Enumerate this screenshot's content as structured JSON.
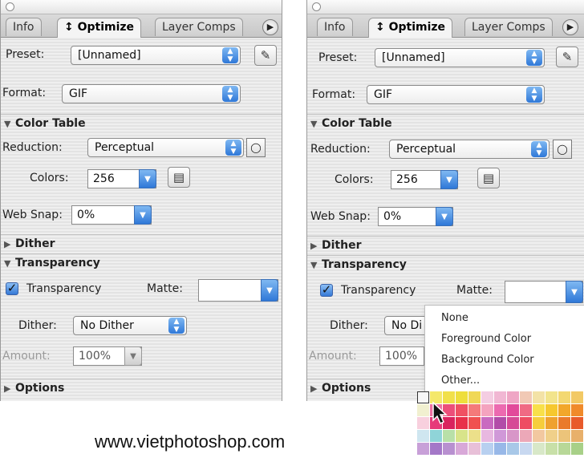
{
  "tabs": {
    "info": "Info",
    "optimize": "↕ Optimize",
    "layer_comps": "Layer Comps",
    "menu_glyph": "▶"
  },
  "settings": {
    "preset_label": "Preset:",
    "preset_value": "[Unnamed]",
    "format_label": "Format:",
    "format_value": "GIF"
  },
  "color_table": {
    "header": "Color Table",
    "reduction_label": "Reduction:",
    "reduction_value": "Perceptual",
    "colors_label": "Colors:",
    "colors_value": "256",
    "web_snap_label": "Web Snap:",
    "web_snap_value": "0%"
  },
  "dither_section": {
    "header": "Dither"
  },
  "transparency": {
    "header": "Transparency",
    "checkbox_label": "Transparency",
    "checked": true,
    "matte_label": "Matte:",
    "matte_value": "",
    "dither_label": "Dither:",
    "dither_value": "No Dither",
    "dither_value_truncated": "No Di",
    "amount_label": "Amount:",
    "amount_value": "100%"
  },
  "options_section": {
    "header": "Options"
  },
  "matte_menu": {
    "items": [
      "None",
      "Foreground Color",
      "Background Color",
      "Other..."
    ]
  },
  "swatch_colors": [
    "#f7f7f7",
    "#f4e86a",
    "#f1e04a",
    "#eede3c",
    "#f0d856",
    "#f4cde2",
    "#f1b7d3",
    "#efa6c5",
    "#f1c9b5",
    "#f3e2a6",
    "#f2e48c",
    "#f3d872",
    "#f2c964",
    "#f1f0d0",
    "#ee6fa0",
    "#ec4f7a",
    "#f05162",
    "#f47a7a",
    "#f4a3bf",
    "#ec6ab0",
    "#e24a9b",
    "#f06a84",
    "#f8e04a",
    "#f6c82f",
    "#f2a72a",
    "#f08a2a",
    "#f8d0de",
    "#e63a7a",
    "#d9235e",
    "#e8304a",
    "#f05050",
    "#c96ac0",
    "#b24ca8",
    "#d64a96",
    "#ee4c62",
    "#f6cd3c",
    "#efa12f",
    "#ea7a2a",
    "#e85a2a",
    "#cfe6f0",
    "#8fd4d8",
    "#b8e0a8",
    "#d8e48a",
    "#ece08a",
    "#e8b8e0",
    "#d098d8",
    "#d896c8",
    "#eca8b8",
    "#f2c8a0",
    "#f0d08a",
    "#ecc47a",
    "#e8b06a",
    "#c8a0d8",
    "#a478c8",
    "#b890d0",
    "#d8a8d8",
    "#e8c0d8",
    "#b8d0f0",
    "#98b8e8",
    "#a8c8e8",
    "#c8d8f0",
    "#d8e8c8",
    "#c8e0a8",
    "#b8d898",
    "#a8d088"
  ],
  "watermark": "www.vietphotoshop.com"
}
